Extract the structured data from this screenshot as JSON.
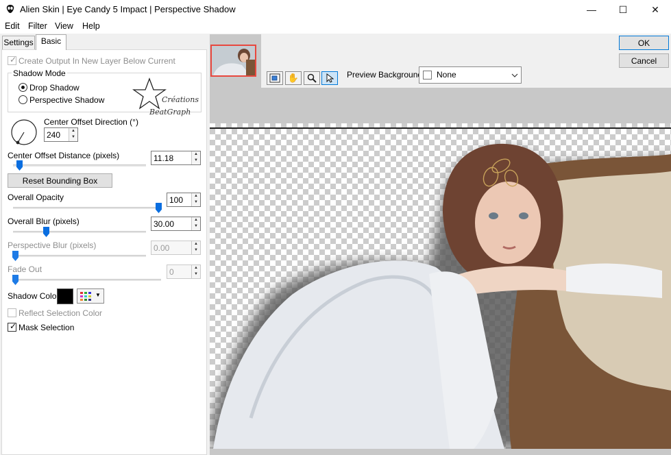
{
  "window": {
    "title": "Alien Skin | Eye Candy 5 Impact | Perspective Shadow",
    "minimize_glyph": "—",
    "maximize_glyph": "☐",
    "close_glyph": "✕"
  },
  "menu": [
    "Edit",
    "Filter",
    "View",
    "Help"
  ],
  "tabs": [
    {
      "label": "Settings",
      "active": false
    },
    {
      "label": "Basic",
      "active": true
    }
  ],
  "basic": {
    "create_output_label": "Create Output In New Layer Below Current",
    "shadow_mode": {
      "title": "Shadow Mode",
      "options": [
        "Drop Shadow",
        "Perspective Shadow"
      ],
      "selected": "Drop Shadow"
    },
    "watermark": {
      "line1": "Créations",
      "line2": "BeatGraph"
    },
    "center_offset_direction": {
      "label": "Center Offset Direction (°)",
      "value": "240"
    },
    "center_offset_distance": {
      "label": "Center Offset Distance (pixels)",
      "value": "11.18",
      "slider": 0.05
    },
    "reset_bounding_box": "Reset Bounding Box",
    "overall_opacity": {
      "label": "Overall Opacity",
      "value": "100",
      "slider": 1.0
    },
    "overall_blur": {
      "label": "Overall Blur (pixels)",
      "value": "30.00",
      "slider": 0.25
    },
    "perspective_blur": {
      "label": "Perspective Blur (pixels)",
      "value": "0.00",
      "slider": 0.0
    },
    "fade_out": {
      "label": "Fade Out",
      "value": "0",
      "slider": 0.0
    },
    "shadow_color_label": "Shadow Color",
    "shadow_color": "#000000",
    "reflect_selection_label": "Reflect Selection Color",
    "mask_selection_label": "Mask Selection",
    "mask_selection_checked": true
  },
  "preview": {
    "background_label": "Preview Background:",
    "background_value": "None",
    "ok_label": "OK",
    "cancel_label": "Cancel",
    "tools": [
      "navigator-icon",
      "hand-icon",
      "zoom-icon",
      "pointer-icon"
    ]
  },
  "colors": {
    "accent": "#0078d7",
    "thumb_border": "#e8473e",
    "slider": "#0a6ee0"
  }
}
